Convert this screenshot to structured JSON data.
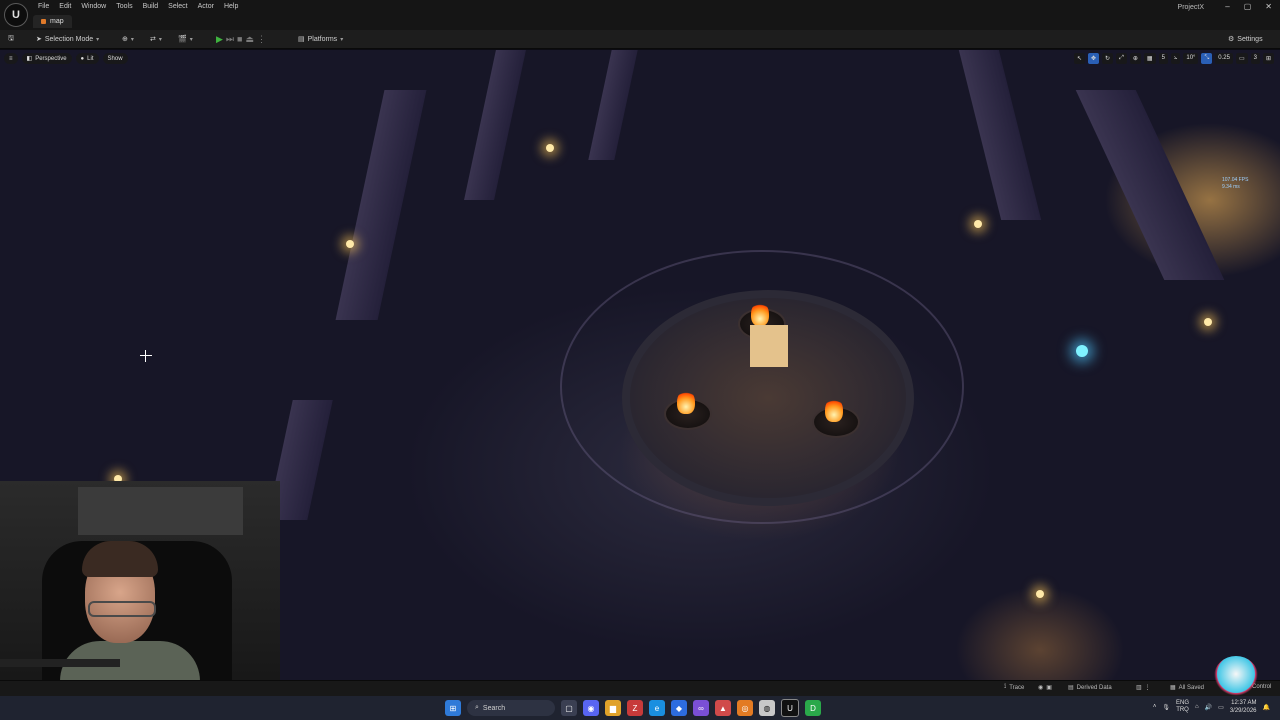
{
  "menubar": {
    "logo": "U",
    "items": [
      "File",
      "Edit",
      "Window",
      "Tools",
      "Build",
      "Select",
      "Actor",
      "Help"
    ],
    "doc_tab": "map",
    "project": "ProjectX",
    "controls": [
      "–",
      "▢",
      "✕"
    ]
  },
  "toolbar": {
    "save_icon": "save-icon",
    "selection_mode": "Selection Mode",
    "platforms": "Platforms",
    "settings": "Settings"
  },
  "viewport": {
    "perspective": "Perspective",
    "lit": "Lit",
    "show": "Show",
    "right_controls": [
      "↖",
      "✥",
      "↻",
      "⤢",
      "⊕",
      "▦",
      "5",
      "⦣",
      "10°",
      "⤡",
      "0.25",
      "▭",
      "3",
      "⊞"
    ],
    "fps_line1": "107.04 FPS",
    "fps_line2": "9.34 ms"
  },
  "statusbar": {
    "trace": "Trace",
    "derived_data": "Derived Data",
    "all_saved": "All Saved",
    "control": "Control"
  },
  "taskbar": {
    "search": "Search",
    "lang_line1": "ENG",
    "lang_line2": "TRQ",
    "time": "12:37 AM",
    "date": "3/29/2026"
  }
}
